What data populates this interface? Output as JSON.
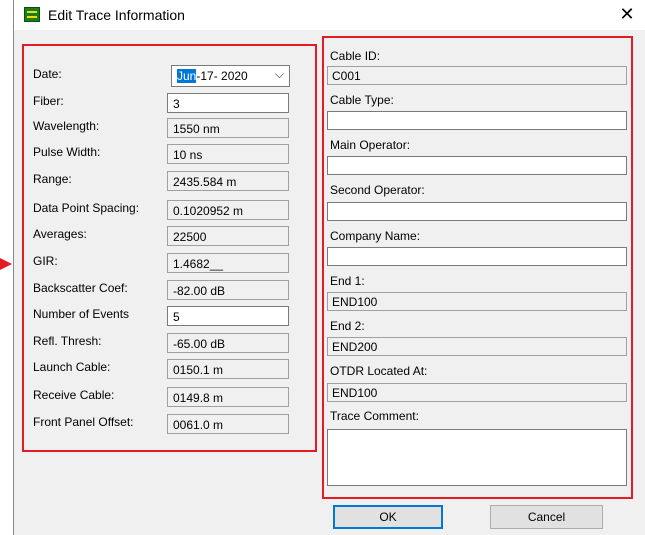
{
  "window": {
    "title": "Edit Trace Information",
    "close_glyph": "✕"
  },
  "icons": {
    "app": "app-logo-icon",
    "close": "close-icon",
    "dropdown": "chevron-down-icon"
  },
  "left": {
    "date": {
      "label": "Date:",
      "month": "Jun",
      "rest": "-17- 2020",
      "chevron": "⌵"
    },
    "fields": [
      {
        "label": "Fiber:",
        "value": "3",
        "editable": true
      },
      {
        "label": "Wavelength:",
        "value": "1550 nm",
        "editable": false
      },
      {
        "label": "Pulse Width:",
        "value": "10 ns",
        "editable": false
      },
      {
        "label": "Range:",
        "value": "2435.584 m",
        "editable": false
      },
      {
        "label": "Data Point Spacing:",
        "value": "0.1020952 m",
        "editable": false
      },
      {
        "label": "Averages:",
        "value": "22500",
        "editable": false
      },
      {
        "label": "GIR:",
        "value": "1.4682__",
        "editable": false
      },
      {
        "label": "Backscatter Coef:",
        "value": "-82.00 dB",
        "editable": false
      },
      {
        "label": "Number of Events",
        "value": "5",
        "editable": true
      },
      {
        "label": "Refl. Thresh:",
        "value": "-65.00 dB",
        "editable": false
      },
      {
        "label": "Launch Cable:",
        "value": "0150.1 m",
        "editable": false
      },
      {
        "label": "Receive Cable:",
        "value": "0149.8 m",
        "editable": false
      },
      {
        "label": "Front Panel Offset:",
        "value": "0061.0 m",
        "editable": false
      }
    ]
  },
  "right": {
    "cable_id_label": "Cable ID:",
    "cable_id": "C001",
    "cable_type_label": "Cable Type:",
    "cable_type": "",
    "main_operator_label": "Main Operator:",
    "main_operator": "",
    "second_operator_label": "Second Operator:",
    "second_operator": "",
    "company_name_label": "Company Name:",
    "company_name": "",
    "end1_label": "End 1:",
    "end1": "END100",
    "end2_label": "End 2:",
    "end2": "END200",
    "otdr_label": "OTDR Located At:",
    "otdr": "END100",
    "comment_label": "Trace Comment:",
    "comment": ""
  },
  "buttons": {
    "ok": "OK",
    "cancel": "Cancel"
  },
  "colors": {
    "highlight_box": "#e31b23",
    "selection": "#0078d7"
  }
}
